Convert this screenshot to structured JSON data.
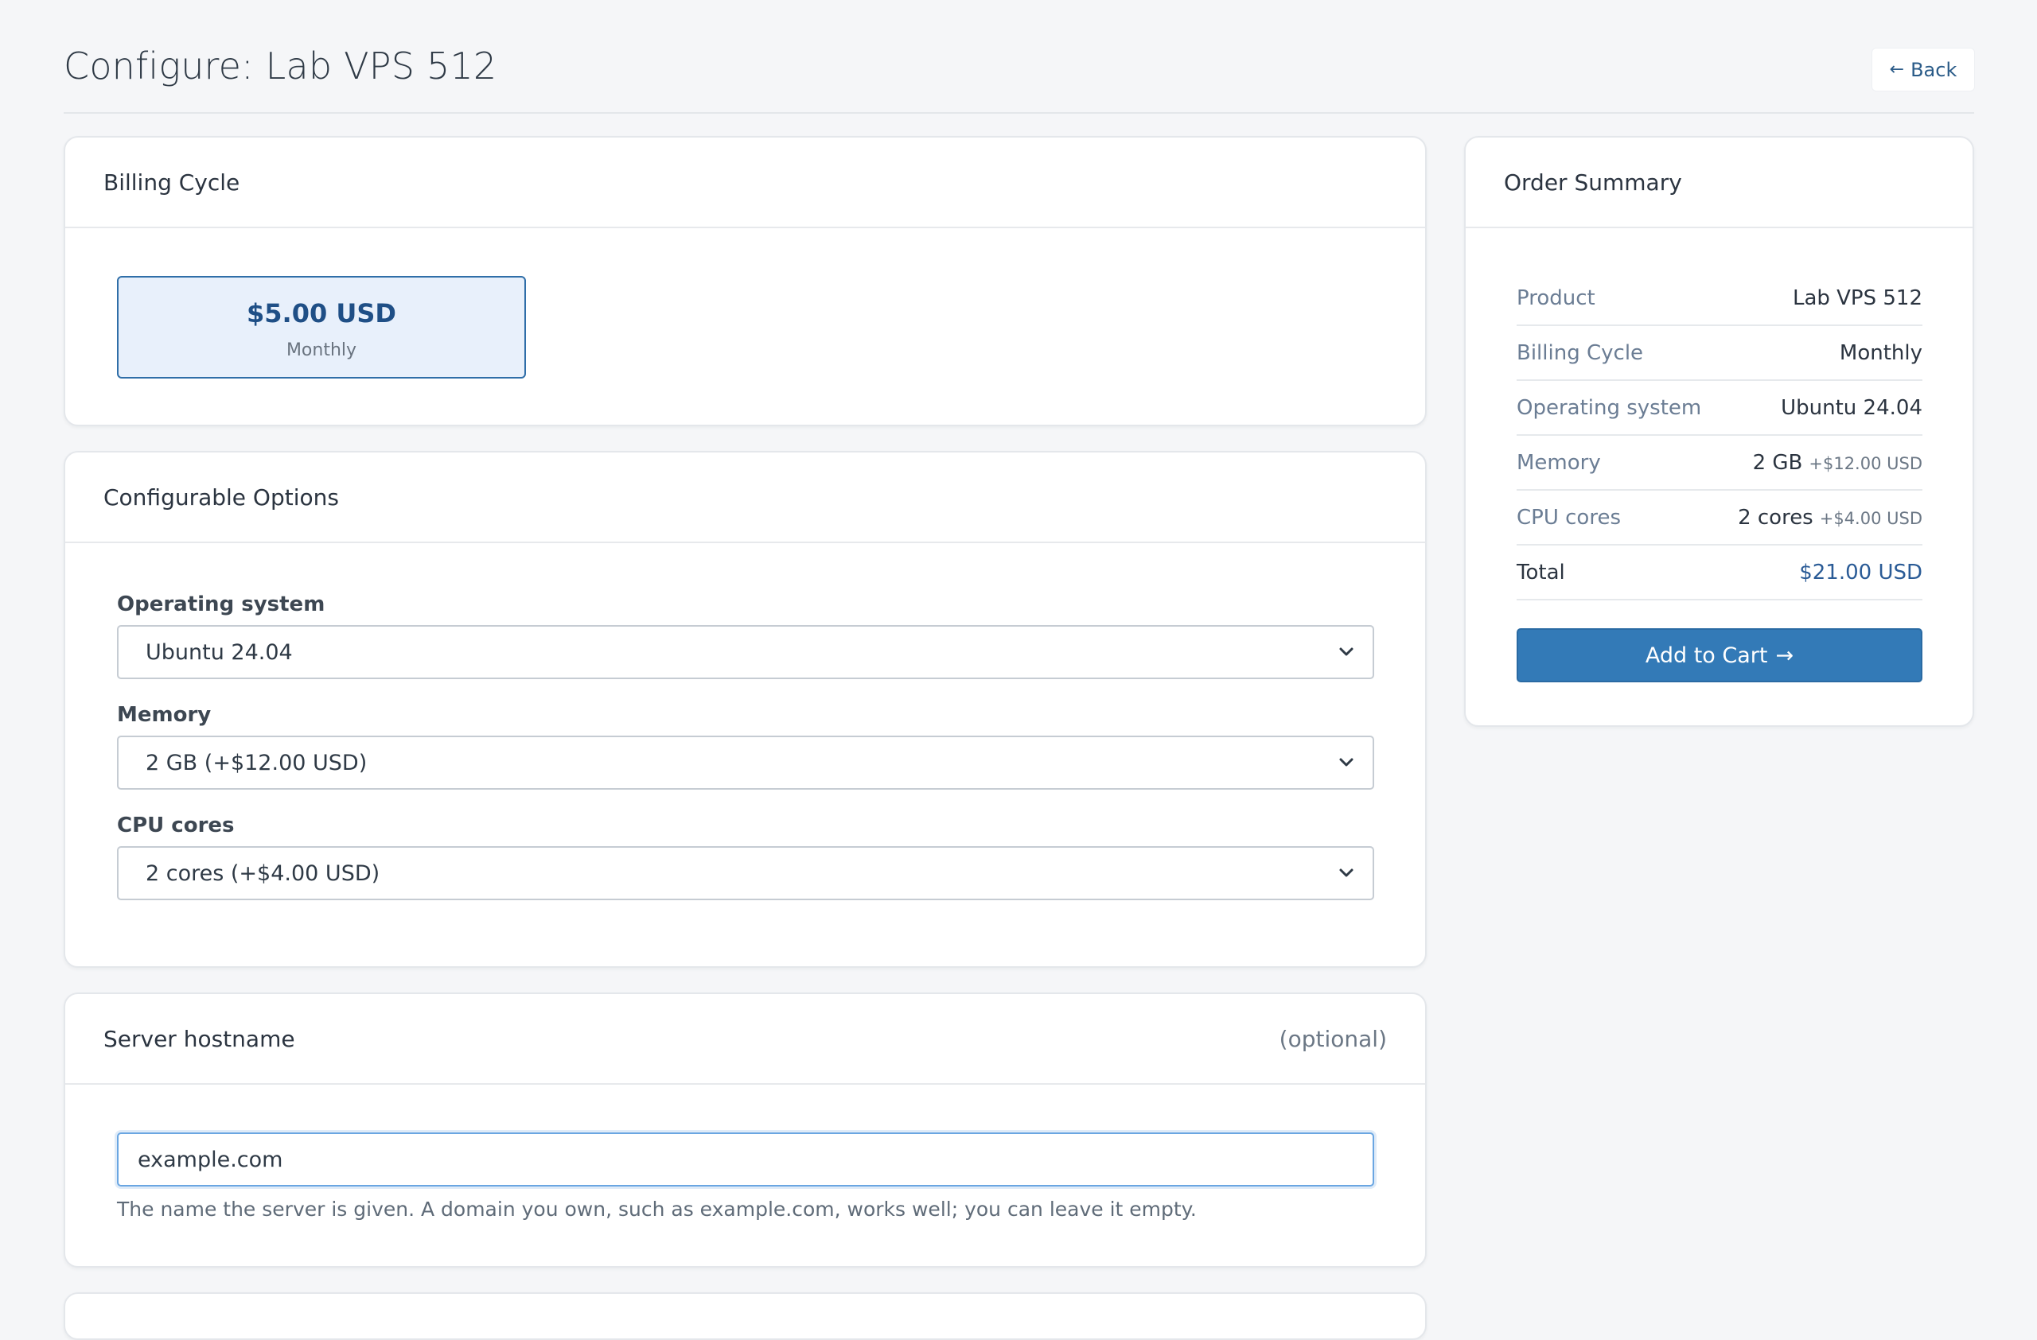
{
  "page": {
    "title": "Configure: Lab VPS 512",
    "back_label": "Back",
    "back_arrow": "←"
  },
  "billing": {
    "title": "Billing Cycle",
    "selected_price": "$5.00 USD",
    "selected_cycle": "Monthly"
  },
  "options": {
    "title": "Configurable Options",
    "fields": [
      {
        "label": "Operating system",
        "value": "Ubuntu 24.04"
      },
      {
        "label": "Memory",
        "value": "2 GB (+$12.00 USD)"
      },
      {
        "label": "CPU cores",
        "value": "2 cores (+$4.00 USD)"
      }
    ]
  },
  "hostname": {
    "title": "Server hostname",
    "optional_note": "(optional)",
    "value": "example.com",
    "help": "The name the server is given. A domain you own, such as example.com, works well; you can leave it empty."
  },
  "summary": {
    "title": "Order Summary",
    "rows": [
      {
        "key": "Product",
        "value": "Lab VPS 512",
        "extra": ""
      },
      {
        "key": "Billing Cycle",
        "value": "Monthly",
        "extra": ""
      },
      {
        "key": "Operating system",
        "value": "Ubuntu 24.04",
        "extra": ""
      },
      {
        "key": "Memory",
        "value": "2 GB",
        "extra": "+$12.00 USD"
      },
      {
        "key": "CPU cores",
        "value": "2 cores",
        "extra": "+$4.00 USD"
      }
    ],
    "total_label": "Total",
    "total_value": "$21.00 USD",
    "add_to_cart_label": "Add to Cart",
    "add_to_cart_arrow": "→"
  },
  "colors": {
    "accent": "#337ab7",
    "selected_border": "#2f6ea8",
    "selected_bg": "#e8f0fb",
    "page_bg": "#f5f6f8"
  }
}
